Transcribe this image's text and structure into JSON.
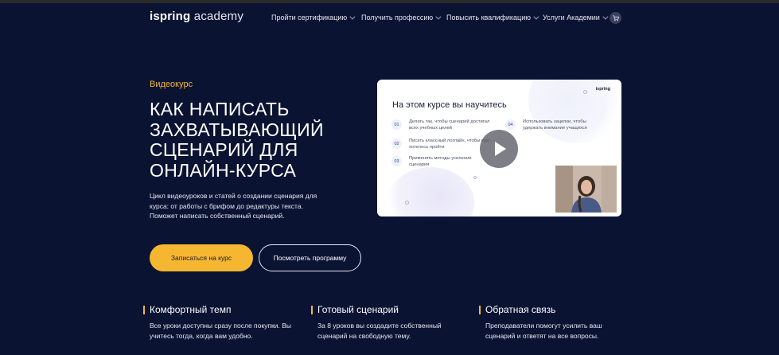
{
  "header": {
    "logo_bold": "ispring",
    "logo_light": " academy",
    "nav": [
      {
        "label": "Пройти сертификацию"
      },
      {
        "label": "Получить профессию"
      },
      {
        "label": "Повысить квалификацию"
      },
      {
        "label": "Услуги Академии"
      }
    ],
    "cart_icon": "cart-icon"
  },
  "hero": {
    "eyebrow": "Видеокурс",
    "title": "КАК НАПИСАТЬ ЗАХВАТЫВАЮЩИЙ СЦЕНАРИЙ ДЛЯ ОНЛАЙН-КУРСА",
    "description": "Цикл видеоуроков и статей о создании сценария для курса: от работы с брифом до редактуры текста. Поможет написать собственный сценарий.",
    "primary_button": "Записаться на курс",
    "secondary_button": "Посмотреть программу"
  },
  "video": {
    "brand": "ispring",
    "title": "На этом курсе вы научитесь",
    "items": [
      {
        "num": "01",
        "text": "Делать так, чтобы сценарий достигал всех учебных целей"
      },
      {
        "num": "02",
        "text": "Писать классный логлайн, чтобы курс хотелось пройти"
      },
      {
        "num": "03",
        "text": "Применять методы усиления сценария"
      },
      {
        "num": "04",
        "text": "Использовать зацепки, чтобы удержать внимание учащихся"
      }
    ]
  },
  "features": [
    {
      "title": "Комфортный темп",
      "text": "Все уроки доступны сразу после покупки. Вы учитесь тогда, когда вам удобно."
    },
    {
      "title": "Готовый сценарий",
      "text": "За 8 уроков вы создадите собственный сценарий на свободную тему."
    },
    {
      "title": "Обратная связь",
      "text": "Преподаватели помогут усилить ваш сценарий и ответят на все вопросы."
    }
  ],
  "colors": {
    "background": "#0b1333",
    "accent": "#f5b731"
  }
}
